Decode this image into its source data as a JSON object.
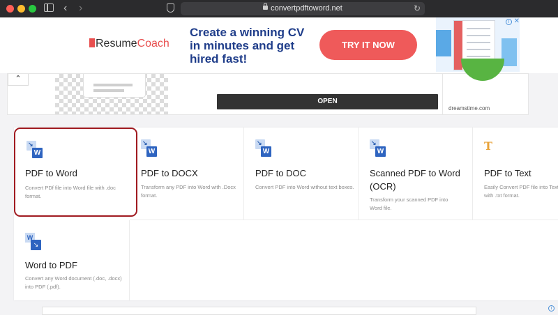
{
  "browser": {
    "url": "convertpdftoword.net",
    "colors": {
      "close": "#fe5f57",
      "minimize": "#febc2e",
      "zoom": "#28c840"
    }
  },
  "ad_banner": {
    "logo_part1": "Resume",
    "logo_part2": "Coach",
    "headline": "Create a winning CV in minutes and get hired fast!",
    "cta": "TRY IT NOW",
    "cta_color": "#ef5a5a",
    "headline_color": "#1f3d8a"
  },
  "ad_secondary": {
    "open_button": "OPEN",
    "source": "dreamstime.com",
    "collapse_glyph": "^"
  },
  "tools": [
    {
      "title": "PDF to Word",
      "description": "Convert PDf file into Word file with .doc format.",
      "icon": "pdf-to-word-icon",
      "selected": true
    },
    {
      "title": "PDF to DOCX",
      "description": "Transform any PDF into Word with .Docx format.",
      "icon": "pdf-to-docx-icon",
      "selected": false
    },
    {
      "title": "PDF to DOC",
      "description": "Convert PDF into Word without text boxes.",
      "icon": "pdf-to-doc-icon",
      "selected": false
    },
    {
      "title": "Scanned PDF to Word (OCR)",
      "description": "Transform your scanned PDF into Word file.",
      "icon": "scanned-pdf-icon",
      "selected": false
    },
    {
      "title": "PDF to Text",
      "description": "Easily Convert PDF file into Text with .txt format.",
      "icon": "text-icon",
      "selected": false
    },
    {
      "title": "Word to PDF",
      "description": "Convert any Word document (.doc, .docx) into PDF (.pdf).",
      "icon": "word-to-pdf-icon",
      "selected": false
    }
  ],
  "accent_color": "#a01a20"
}
